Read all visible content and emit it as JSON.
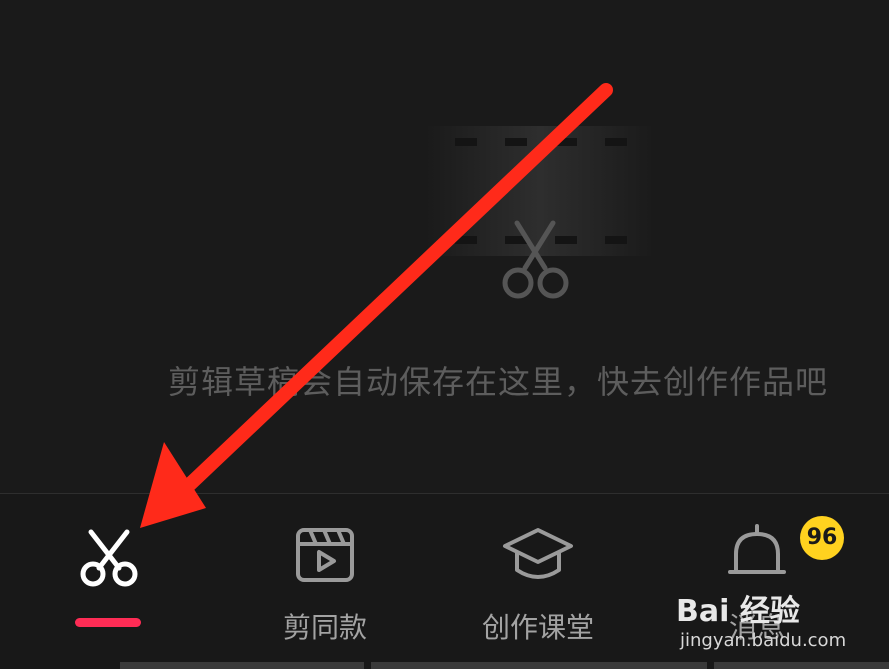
{
  "empty_state": {
    "message": "剪辑草稿会自动保存在这里，快去创作作品吧"
  },
  "tabs": [
    {
      "id": "edit",
      "label": "",
      "icon": "scissors-icon",
      "active": true
    },
    {
      "id": "templates",
      "label": "剪同款",
      "icon": "clapperboard-play-icon",
      "active": false
    },
    {
      "id": "course",
      "label": "创作课堂",
      "icon": "graduation-cap-icon",
      "active": false
    },
    {
      "id": "messages",
      "label": "消息",
      "icon": "bell-icon",
      "active": false
    }
  ],
  "messages_badge": "96",
  "watermark": {
    "brand": "Bai 经验",
    "url": "jingyan.baidu.com"
  },
  "colors": {
    "background": "#191919",
    "accent_indicator": "#fe2c55",
    "badge": "#ffd21f",
    "annotation_arrow": "#ff2a1a"
  }
}
